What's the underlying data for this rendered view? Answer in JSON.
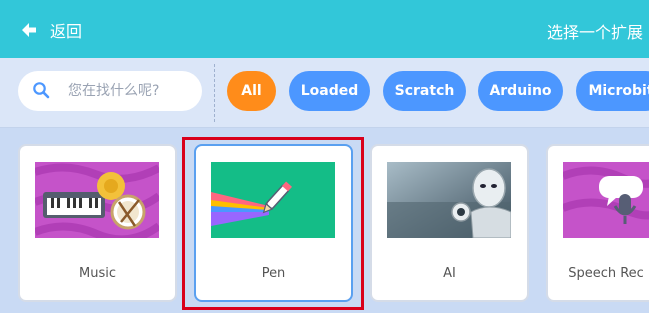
{
  "header": {
    "back_label": "返回",
    "title": "选择一个扩展"
  },
  "search": {
    "placeholder": "您在找什么呢?"
  },
  "filters": [
    {
      "label": "All",
      "active": true
    },
    {
      "label": "Loaded",
      "active": false
    },
    {
      "label": "Scratch",
      "active": false
    },
    {
      "label": "Arduino",
      "active": false
    },
    {
      "label": "Microbit",
      "active": false
    }
  ],
  "extensions": [
    {
      "name": "Music",
      "selected": false
    },
    {
      "name": "Pen",
      "selected": true
    },
    {
      "name": "AI",
      "selected": false
    },
    {
      "name": "Speech Rec",
      "selected": false
    }
  ],
  "colors": {
    "header": "#32c7d9",
    "chip_default": "#4c97ff",
    "chip_active": "#ff8c1a",
    "highlight": "#d9001b",
    "music_bg": "#c553c9",
    "pen_bg": "#14bd87"
  }
}
